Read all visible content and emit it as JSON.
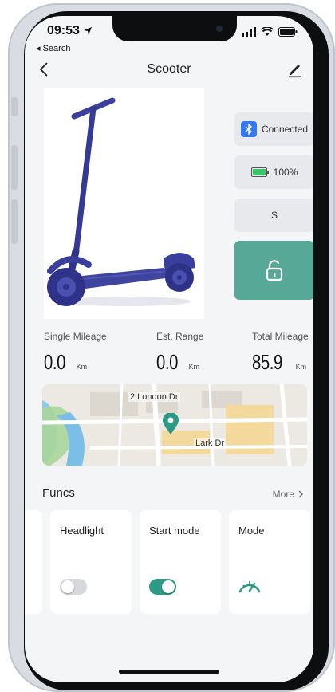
{
  "status_bar": {
    "time": "09:53",
    "back_label": "◂ Search",
    "icons": [
      "location-arrow-icon",
      "signal-icon",
      "wifi-icon",
      "battery-icon"
    ]
  },
  "nav": {
    "title": "Scooter",
    "back_icon": "chevron-left-icon",
    "edit_icon": "pencil-icon"
  },
  "device": {
    "connection_status": "Connected",
    "battery": "100%",
    "speed_mode": "S",
    "battery_level": 1.0,
    "lock_icon": "unlock-icon"
  },
  "stats": [
    {
      "label": "Single Mileage",
      "value": "0.0",
      "unit": "Km"
    },
    {
      "label": "Est. Range",
      "value": "0.0",
      "unit": "Km"
    },
    {
      "label": "Total Mileage",
      "value": "85.9",
      "unit": "Km"
    }
  ],
  "map": {
    "label_top": "2 London Dr",
    "label_poi": "Lark Dr"
  },
  "funcs": {
    "title": "Funcs",
    "more_label": "More",
    "cards": [
      {
        "label": "Headlight",
        "type": "toggle",
        "on": false
      },
      {
        "label": "Start mode",
        "type": "toggle",
        "on": true
      },
      {
        "label": "Mode",
        "type": "gauge",
        "icon": "speedometer-icon"
      }
    ]
  },
  "colors": {
    "accent": "#58a897",
    "bluetooth": "#3478f6",
    "battery": "#3cc46a",
    "scooter": "#3a3f9e"
  }
}
